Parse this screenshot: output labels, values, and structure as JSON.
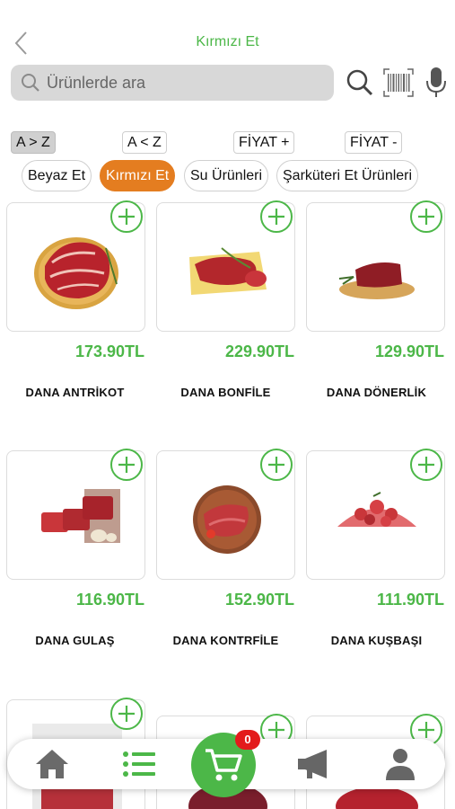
{
  "header": {
    "title": "Kırmızı Et"
  },
  "search": {
    "placeholder": "Ürünlerde ara"
  },
  "sort": [
    "A > Z",
    "A < Z",
    "FİYAT +",
    "FİYAT -"
  ],
  "categories": [
    {
      "label": "Beyaz Et",
      "active": false
    },
    {
      "label": "Kırmızı Et",
      "active": true
    },
    {
      "label": "Su Ürünleri",
      "active": false
    },
    {
      "label": "Şarküteri Et Ürünleri",
      "active": false
    }
  ],
  "products": [
    {
      "name": "DANA ANTRİKOT",
      "price": "173.90TL"
    },
    {
      "name": "DANA BONFİLE",
      "price": "229.90TL"
    },
    {
      "name": "DANA DÖNERLİK",
      "price": "129.90TL"
    },
    {
      "name": "DANA GULAŞ",
      "price": "116.90TL"
    },
    {
      "name": "DANA KONTRFİLE",
      "price": "152.90TL"
    },
    {
      "name": "DANA KUŞBAŞI",
      "price": "111.90TL"
    }
  ],
  "cart": {
    "count": "0"
  },
  "colors": {
    "accent": "#4cb748",
    "active_chip": "#e47d20",
    "badge": "#e31b1b"
  },
  "icons": [
    "back-chevron-icon",
    "search-icon",
    "barcode-icon",
    "microphone-icon",
    "add-circle-icon",
    "home-icon",
    "list-icon",
    "cart-icon",
    "megaphone-icon",
    "user-icon"
  ]
}
